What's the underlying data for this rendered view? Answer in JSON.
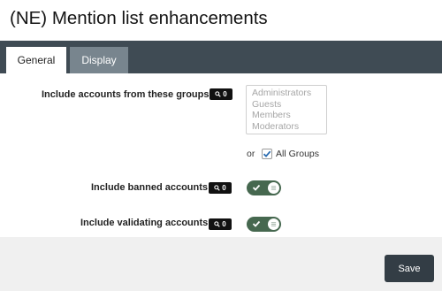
{
  "page": {
    "title": "(NE) Mention list enhancements"
  },
  "tabs": [
    {
      "label": "General",
      "active": true
    },
    {
      "label": "Display",
      "active": false
    }
  ],
  "settings": {
    "groups": {
      "label": "Include accounts from these groups",
      "badge_count": "0",
      "badge_icon": "search-icon",
      "options": [
        "Administrators",
        "Guests",
        "Members",
        "Moderators"
      ],
      "or_text": "or",
      "all_groups_label": "All Groups",
      "all_groups_checked": true
    },
    "banned": {
      "label": "Include banned accounts",
      "badge_count": "0",
      "badge_icon": "search-icon",
      "enabled": true
    },
    "validating": {
      "label": "Include validating accounts",
      "badge_count": "0",
      "badge_icon": "search-icon",
      "enabled": true
    }
  },
  "footer": {
    "save_label": "Save"
  },
  "colors": {
    "tab_strip": "#3f4b54",
    "inactive_tab": "#78858e",
    "toggle_on": "#46684f",
    "checkbox_accent": "#2b6cb0",
    "save_button": "#333d45",
    "footer_bg": "#f0f0f0"
  }
}
